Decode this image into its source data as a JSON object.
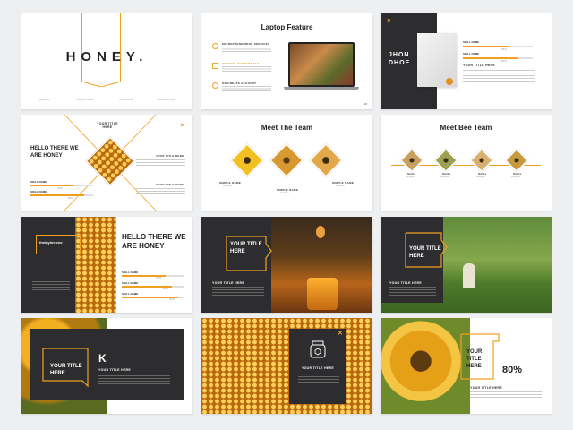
{
  "colors": {
    "accent": "#f0a020",
    "dark": "#2d2d2f"
  },
  "s1": {
    "title": "HONEY.",
    "tabs": [
      "DESIGN",
      "PRODUCTIVE",
      "CREATIVE",
      "MARKETING"
    ]
  },
  "s2": {
    "title": "Laptop Feature",
    "items": [
      {
        "icon": "team-icon",
        "title": "ENTREPRENEURING SERVICES"
      },
      {
        "icon": "tools-icon",
        "title": "WEBSITE SUPPORT 24/7"
      },
      {
        "icon": "money-icon",
        "title": "ON CREATE ACCOUNT"
      }
    ],
    "page": "18"
  },
  "s3": {
    "name": "JHON DHOE",
    "title": "YOUR TITLE HERE",
    "bar1": "SKILL NAME",
    "bar2": "SKILL NAME",
    "p1": "65%",
    "p2": "80%",
    "v1": 0.65,
    "v2": 0.8,
    "icon": "close-icon"
  },
  "s4": {
    "heading": "HELLO THERE WE ARE HONEY",
    "corner_title": "YOUR TITLE HERE",
    "t1": "YOUR TITLE HERE",
    "t2": "YOUR TITLE HERE",
    "bar1": "SKILL NAME",
    "bar2": "SKILL NAME",
    "p1": "70%",
    "p2": "85%",
    "v1": 0.7,
    "v2": 0.85,
    "icon": "close-icon"
  },
  "s5": {
    "title": "Meet The Team",
    "members": [
      {
        "name": "SIMPLE NAME",
        "role": "Designer"
      },
      {
        "name": "SIMPLE NAME",
        "role": "Designer"
      },
      {
        "name": "SIMPLE NAME",
        "role": "Designer"
      }
    ]
  },
  "s6": {
    "title": "Meet Bee Team",
    "members": [
      {
        "name": "Smile",
        "role": "Designer"
      },
      {
        "name": "Smile",
        "role": "Designer"
      },
      {
        "name": "Smile",
        "role": "Designer"
      },
      {
        "name": "Smile",
        "role": "Designer"
      }
    ]
  },
  "s7": {
    "label": "theinyine ceo",
    "heading": "HELLO THERE WE ARE HONEY",
    "bar1": "SKILL NAME",
    "bar2": "SKILL NAME",
    "bar3": "SKILL NAME",
    "p1": "70%",
    "p2": "80%",
    "p3": "90%",
    "v1": 0.7,
    "v2": 0.8,
    "v3": 0.9
  },
  "s8": {
    "title": "YOUR TITLE HERE",
    "sub": "YOUR TITLE HERE"
  },
  "s9": {
    "title": "YOUR TITLE HERE",
    "sub": "YOUR TITLE HERE"
  },
  "s10": {
    "title": "YOUR TITLE HERE",
    "letter": "K",
    "sub": "YOUR TITLE HERE"
  },
  "s11": {
    "sub": "YOUR TITLE HERE",
    "icon": "honey-jar-icon",
    "close": "close-icon"
  },
  "s12": {
    "title": "YOUR TITLE HERE",
    "percent": "80%",
    "sub": "YOUR TITLE HERE"
  }
}
